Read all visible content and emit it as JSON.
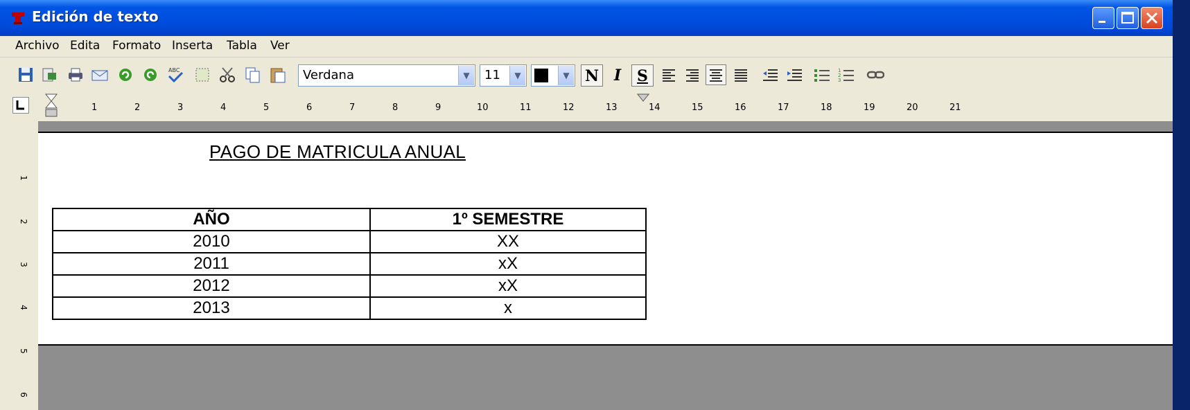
{
  "window": {
    "title": "Edición de texto"
  },
  "menu": [
    "Archivo",
    "Edita",
    "Formato",
    "Inserta",
    "Tabla",
    "Ver"
  ],
  "toolbar": {
    "font_name": "Verdana",
    "font_size": "11",
    "bold_label": "N",
    "italic_label": "I",
    "underline_label": "S",
    "icons": [
      "save-icon",
      "export-icon",
      "print-icon",
      "email-icon",
      "undo-icon",
      "redo-icon",
      "spellcheck-icon",
      "select-all-icon",
      "cut-icon",
      "copy-icon",
      "paste-icon"
    ]
  },
  "ruler": {
    "numbers": [
      "1",
      "2",
      "3",
      "4",
      "5",
      "6",
      "7",
      "8",
      "9",
      "10",
      "11",
      "12",
      "13",
      "14",
      "15",
      "16",
      "17",
      "18",
      "19",
      "20",
      "21"
    ],
    "vnumbers": [
      "1",
      "2",
      "3",
      "4",
      "5",
      "6"
    ]
  },
  "document": {
    "title": "PAGO DE MATRICULA ANUAL",
    "table": {
      "headers": [
        "AÑO",
        "1º SEMESTRE"
      ],
      "rows": [
        [
          "2010",
          "XX"
        ],
        [
          "2011",
          "xX"
        ],
        [
          "2012",
          "xX"
        ],
        [
          "2013",
          "x"
        ]
      ]
    }
  },
  "colors": {
    "titlebar": "#0055e5",
    "chrome": "#ece9d8",
    "workspace": "#8e8e8e"
  }
}
